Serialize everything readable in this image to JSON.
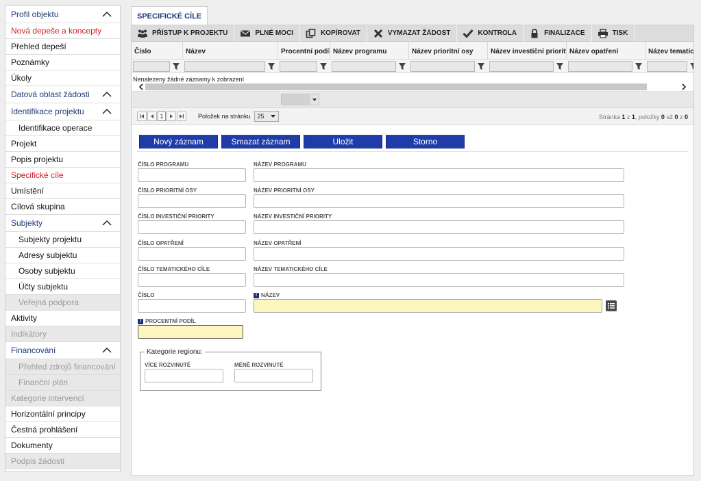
{
  "sidebar": {
    "items": [
      {
        "label": "Profil objektu",
        "type": "section",
        "chevron": true
      },
      {
        "label": "Nová depeše a koncepty",
        "type": "red"
      },
      {
        "label": "Přehled depeší",
        "type": "item"
      },
      {
        "label": "Poznámky",
        "type": "item"
      },
      {
        "label": "Úkoly",
        "type": "item"
      },
      {
        "label": "Datová oblast žádosti",
        "type": "section",
        "chevron": true
      },
      {
        "label": "Identifikace projektu",
        "type": "section",
        "chevron": true
      },
      {
        "label": "Identifikace operace",
        "type": "sub"
      },
      {
        "label": "Projekt",
        "type": "item"
      },
      {
        "label": "Popis projektu",
        "type": "item"
      },
      {
        "label": "Specifické cíle",
        "type": "red"
      },
      {
        "label": "Umístění",
        "type": "item"
      },
      {
        "label": "Cílová skupina",
        "type": "item"
      },
      {
        "label": "Subjekty",
        "type": "section",
        "chevron": true
      },
      {
        "label": "Subjekty projektu",
        "type": "sub"
      },
      {
        "label": "Adresy subjektu",
        "type": "sub"
      },
      {
        "label": "Osoby subjektu",
        "type": "sub"
      },
      {
        "label": "Účty subjektu",
        "type": "sub"
      },
      {
        "label": "Veřejná podpora",
        "type": "sub-disabled"
      },
      {
        "label": "Aktivity",
        "type": "item"
      },
      {
        "label": "Indikátory",
        "type": "disabled"
      },
      {
        "label": "Financování",
        "type": "section",
        "chevron": true
      },
      {
        "label": "Přehled zdrojů financování",
        "type": "sub-disabled"
      },
      {
        "label": "Finanční plán",
        "type": "sub-disabled"
      },
      {
        "label": "Kategorie intervencí",
        "type": "disabled"
      },
      {
        "label": "Horizontální principy",
        "type": "item"
      },
      {
        "label": "Čestná prohlášení",
        "type": "item"
      },
      {
        "label": "Dokumenty",
        "type": "item"
      },
      {
        "label": "Podpis žádosti",
        "type": "disabled"
      }
    ]
  },
  "tab": {
    "label": "SPECIFICKÉ CÍLE"
  },
  "toolbar": {
    "buttons": [
      {
        "label": "PŘÍSTUP K PROJEKTU",
        "icon": "people-icon"
      },
      {
        "label": "PLNÉ MOCI",
        "icon": "envelope-icon"
      },
      {
        "label": "KOPÍROVAT",
        "icon": "copy-icon"
      },
      {
        "label": "VYMAZAT ŽÁDOST",
        "icon": "close-icon"
      },
      {
        "label": "KONTROLA",
        "icon": "check-icon"
      },
      {
        "label": "FINALIZACE",
        "icon": "lock-icon"
      },
      {
        "label": "TISK",
        "icon": "printer-icon"
      }
    ]
  },
  "grid": {
    "columns": [
      "Číslo",
      "Název",
      "Procentní podíl",
      "Název programu",
      "Název prioritní osy",
      "Název investiční priority",
      "Název opatření",
      "Název tematického"
    ],
    "empty_message": "Nenalezeny žádné záznamy k zobrazení"
  },
  "pager": {
    "current_page": "1",
    "per_page_label": "Položek na stránku",
    "per_page_value": "25",
    "info_prefix": "Stránka ",
    "info_page": "1",
    "info_mid1": " z ",
    "info_total_pages": "1",
    "info_mid2": ", položky ",
    "info_from": "0",
    "info_mid3": " až ",
    "info_to": "0",
    "info_mid4": " z ",
    "info_total": "0"
  },
  "actions": {
    "new": "Nový záznam",
    "delete": "Smazat záznam",
    "save": "Uložit",
    "cancel": "Storno"
  },
  "form": {
    "cislo_programu": "ČÍSLO PROGRAMU",
    "nazev_programu": "NÁZEV PROGRAMU",
    "cislo_prioritni_osy": "ČÍSLO PRIORITNÍ OSY",
    "nazev_prioritni_osy": "NÁZEV PRIORITNÍ OSY",
    "cislo_investicni_priority": "ČÍSLO INVESTIČNÍ PRIORITY",
    "nazev_investicni_priority": "NÁZEV INVESTIČNÍ PRIORITY",
    "cislo_opatreni": "ČÍSLO OPATŘENÍ",
    "nazev_opatreni": "NÁZEV OPATŘENÍ",
    "cislo_tematickeho_cile": "ČÍSLO TEMATICKÉHO CÍLE",
    "nazev_tematickeho_cile": "NÁZEV TEMATICKÉHO CÍLE",
    "cislo": "ČÍSLO",
    "nazev": "NÁZEV",
    "procentni_podil": "PROCENTNÍ PODÍL",
    "required_marker": "!",
    "region_legend": "Kategorie regionu:",
    "vice_rozvinute": "VÍCE ROZVINUTÉ",
    "mene_rozvinute": "MÉNĚ ROZVINUTÉ"
  },
  "colors": {
    "accent_blue": "#1f3ca8",
    "required_field": "#fdf6be",
    "active_red": "#d0202a",
    "section_blue": "#1f3a7a"
  }
}
